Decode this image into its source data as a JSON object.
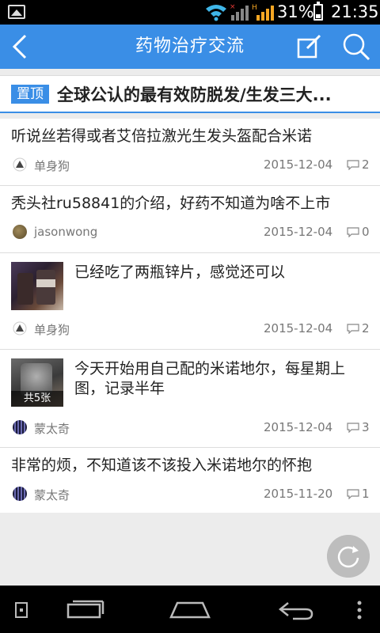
{
  "status": {
    "battery": "31%",
    "time": "21:35",
    "network_label": "H"
  },
  "appbar": {
    "title": "药物治疗交流"
  },
  "pinned": {
    "badge": "置顶",
    "title": "全球公认的最有效防脱发/生发三大..."
  },
  "posts": [
    {
      "title": "听说丝若得或者艾倍拉激光生发头盔配合米诺",
      "author": "单身狗",
      "date": "2015-12-04",
      "comments": "2"
    },
    {
      "title": "秃头社ru58841的介绍，好药不知道为啥不上市",
      "author": "jasonwong",
      "date": "2015-12-04",
      "comments": "0"
    },
    {
      "title": "已经吃了两瓶锌片，感觉还可以",
      "author": "单身狗",
      "date": "2015-12-04",
      "comments": "2"
    },
    {
      "title_line1": "今天开始用自己配的米诺地尔，每星期上",
      "title_line2": "图，记录半年",
      "image_caption": "共5张",
      "author": "蒙太奇",
      "date": "2015-12-04",
      "comments": "3"
    },
    {
      "title": "非常的烦，不知道该不该投入米诺地尔的怀抱",
      "author": "蒙太奇",
      "date": "2015-11-20",
      "comments": "1"
    }
  ],
  "colors": {
    "accent": "#3a8ee6",
    "status_bar": "#000000",
    "background": "#ececec"
  }
}
